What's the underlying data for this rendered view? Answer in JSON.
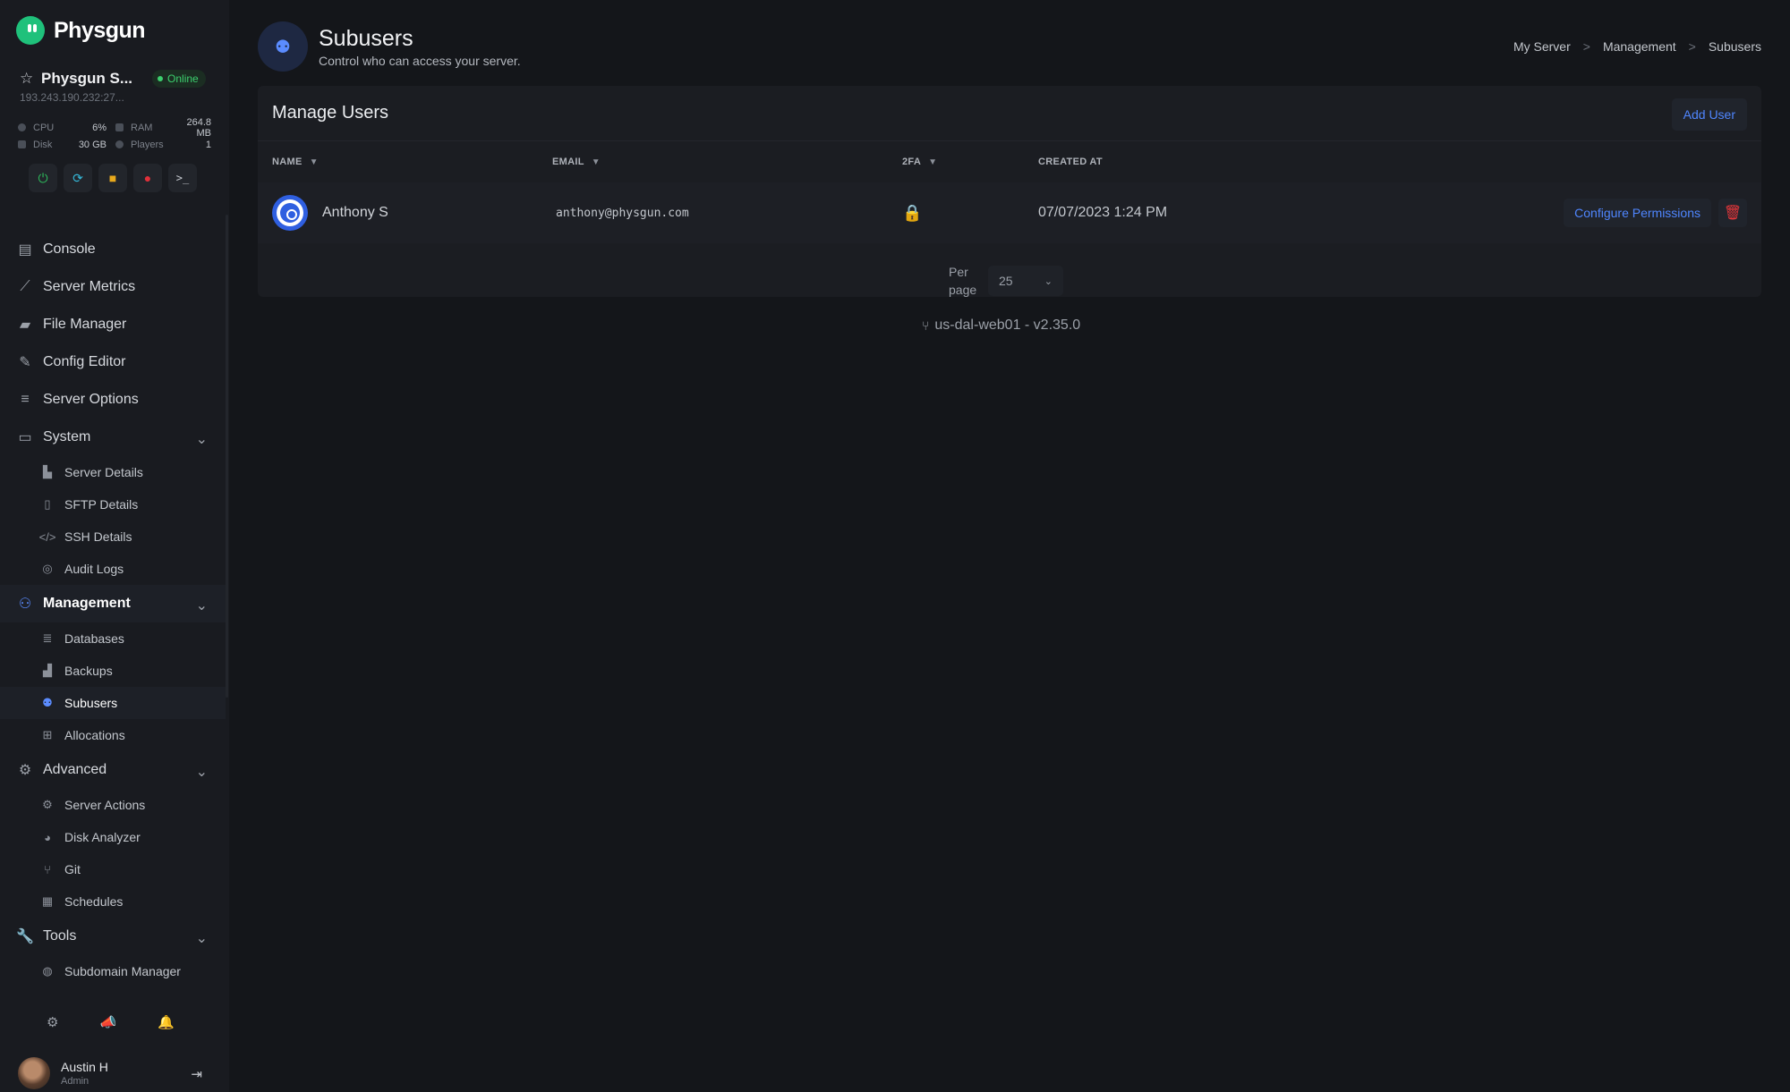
{
  "app": {
    "name": "Physgun"
  },
  "server": {
    "name": "Physgun S...",
    "status": "Online",
    "ip": "193.243.190.232:27...",
    "stats": {
      "cpu_label": "CPU",
      "cpu_value": "6%",
      "ram_label": "RAM",
      "ram_value": "264.8 MB",
      "disk_label": "Disk",
      "disk_value": "30 GB",
      "players_label": "Players",
      "players_value": "1"
    }
  },
  "nav": {
    "console": "Console",
    "server_metrics": "Server Metrics",
    "file_manager": "File Manager",
    "config_editor": "Config Editor",
    "server_options": "Server Options",
    "system": "System",
    "server_details": "Server Details",
    "sftp_details": "SFTP Details",
    "ssh_details": "SSH Details",
    "audit_logs": "Audit Logs",
    "management": "Management",
    "databases": "Databases",
    "backups": "Backups",
    "subusers": "Subusers",
    "allocations": "Allocations",
    "advanced": "Advanced",
    "server_actions": "Server Actions",
    "disk_analyzer": "Disk Analyzer",
    "git": "Git",
    "schedules": "Schedules",
    "tools": "Tools",
    "subdomain_manager": "Subdomain Manager"
  },
  "current_user": {
    "name": "Austin H",
    "role": "Admin"
  },
  "page": {
    "title": "Subusers",
    "subtitle": "Control who can access your server."
  },
  "breadcrumb": [
    "My Server",
    "Management",
    "Subusers"
  ],
  "card": {
    "title": "Manage Users",
    "add_user": "Add User"
  },
  "table": {
    "columns": {
      "name": "NAME",
      "email": "EMAIL",
      "twofa": "2FA",
      "created_at": "CREATED AT"
    },
    "rows": [
      {
        "name": "Anthony S",
        "email": "anthony@physgun.com",
        "twofa": "enabled",
        "created_at": "07/07/2023 1:24 PM",
        "configure": "Configure Permissions"
      }
    ]
  },
  "pagination": {
    "per_page_label": "Per page",
    "per_page_value": "25"
  },
  "footer": {
    "version": "us-dal-web01 - v2.35.0"
  },
  "colors": {
    "accent": "#4f86ff",
    "brand": "#1fc17b",
    "online": "#3ccf6e",
    "danger": "#e5363a",
    "twofa": "#21c45a"
  }
}
